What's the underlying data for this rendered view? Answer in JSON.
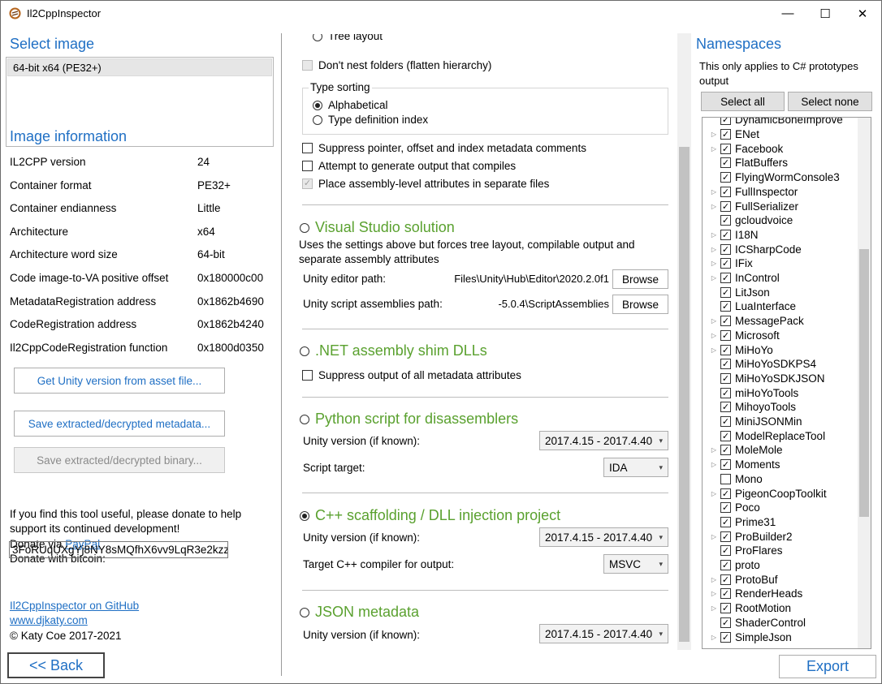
{
  "window": {
    "title": "Il2CppInspector",
    "min": "—",
    "max": "☐",
    "close": "✕"
  },
  "select_image": {
    "heading": "Select image",
    "items": [
      "64-bit x64 (PE32+)"
    ]
  },
  "image_info": {
    "heading": "Image information",
    "rows": [
      {
        "label": "IL2CPP version",
        "value": "24"
      },
      {
        "label": "Container format",
        "value": "PE32+"
      },
      {
        "label": "Container endianness",
        "value": "Little"
      },
      {
        "label": "Architecture",
        "value": "x64"
      },
      {
        "label": "Architecture word size",
        "value": "64-bit"
      },
      {
        "label": "Code image-to-VA positive offset",
        "value": "0x180000c00"
      },
      {
        "label": "MetadataRegistration address",
        "value": "0x1862b4690"
      },
      {
        "label": "CodeRegistration address",
        "value": "0x1862b4240"
      },
      {
        "label": "Il2CppCodeRegistration function",
        "value": "0x1800d0350"
      }
    ]
  },
  "buttons": {
    "get_unity": "Get Unity version from asset file...",
    "save_metadata": "Save extracted/decrypted metadata...",
    "save_binary": "Save extracted/decrypted binary...",
    "back": "<< Back",
    "export": "Export",
    "select_all": "Select all",
    "select_none": "Select none",
    "browse1": "Browse",
    "browse2": "Browse"
  },
  "donate": {
    "line1": "If you find this tool useful, please donate to help",
    "line2": "support its continued development!",
    "via": "Donate via ",
    "paypal": "PayPal",
    "bitcoin_label": "Donate with bitcoin:",
    "bitcoin_addr": "3FoRUqUXgYj8NY8sMQfhX6vv9LqR3e2kzz"
  },
  "links": {
    "github": "Il2CppInspector on GitHub",
    "site": "www.djkaty.com",
    "copyright": "© Katy Coe 2017-2021"
  },
  "options": {
    "tree_layout": "Tree layout",
    "dont_nest": "Don't nest folders (flatten hierarchy)",
    "type_sorting": "Type sorting",
    "alphabetical": "Alphabetical",
    "type_def_index": "Type definition index",
    "suppress_pointer": "Suppress pointer, offset and index metadata comments",
    "attempt_compile": "Attempt to generate output that compiles",
    "place_attrs": "Place assembly-level attributes in separate files"
  },
  "vs": {
    "heading": "Visual Studio solution",
    "desc1": "Uses the settings above but forces tree layout, compilable output and",
    "desc2": "separate assembly attributes",
    "editor_label": "Unity editor path:",
    "editor_path": "Files\\Unity\\Hub\\Editor\\2020.2.0f1",
    "script_label": "Unity script assemblies path:",
    "script_path": "-5.0.4\\ScriptAssemblies"
  },
  "shim": {
    "heading": ".NET assembly shim DLLs",
    "suppress": "Suppress output of all metadata attributes"
  },
  "python": {
    "heading": "Python script for disassemblers",
    "unity_label": "Unity version (if known):",
    "unity_value": "2017.4.15 - 2017.4.40",
    "target_label": "Script target:",
    "target_value": "IDA"
  },
  "cpp": {
    "heading": "C++ scaffolding / DLL injection project",
    "unity_label": "Unity version (if known):",
    "unity_value": "2017.4.15 - 2017.4.40",
    "compiler_label": "Target C++ compiler for output:",
    "compiler_value": "MSVC"
  },
  "json": {
    "heading": "JSON metadata",
    "unity_label": "Unity version (if known):",
    "unity_value": "2017.4.15 - 2017.4.40"
  },
  "namespaces": {
    "heading": "Namespaces",
    "note1": "This only applies to C# prototypes",
    "note2": "output",
    "items": [
      {
        "name": "DynamicBoneImprove",
        "exp": false,
        "chk": true
      },
      {
        "name": "ENet",
        "exp": true,
        "chk": true
      },
      {
        "name": "Facebook",
        "exp": true,
        "chk": true
      },
      {
        "name": "FlatBuffers",
        "exp": false,
        "chk": true
      },
      {
        "name": "FlyingWormConsole3",
        "exp": false,
        "chk": true
      },
      {
        "name": "FullInspector",
        "exp": true,
        "chk": true
      },
      {
        "name": "FullSerializer",
        "exp": true,
        "chk": true
      },
      {
        "name": "gcloudvoice",
        "exp": false,
        "chk": true
      },
      {
        "name": "I18N",
        "exp": true,
        "chk": true
      },
      {
        "name": "ICSharpCode",
        "exp": true,
        "chk": true
      },
      {
        "name": "IFix",
        "exp": true,
        "chk": true
      },
      {
        "name": "InControl",
        "exp": true,
        "chk": true
      },
      {
        "name": "LitJson",
        "exp": false,
        "chk": true
      },
      {
        "name": "LuaInterface",
        "exp": false,
        "chk": true
      },
      {
        "name": "MessagePack",
        "exp": true,
        "chk": true
      },
      {
        "name": "Microsoft",
        "exp": true,
        "chk": true
      },
      {
        "name": "MiHoYo",
        "exp": true,
        "chk": true
      },
      {
        "name": "MiHoYoSDKPS4",
        "exp": false,
        "chk": true
      },
      {
        "name": "MiHoYoSDKJSON",
        "exp": false,
        "chk": true
      },
      {
        "name": "miHoYoTools",
        "exp": false,
        "chk": true
      },
      {
        "name": "MihoyoTools",
        "exp": false,
        "chk": true
      },
      {
        "name": "MiniJSONMin",
        "exp": false,
        "chk": true
      },
      {
        "name": "ModelReplaceTool",
        "exp": false,
        "chk": true
      },
      {
        "name": "MoleMole",
        "exp": true,
        "chk": true
      },
      {
        "name": "Moments",
        "exp": true,
        "chk": true
      },
      {
        "name": "Mono",
        "exp": false,
        "chk": false
      },
      {
        "name": "PigeonCoopToolkit",
        "exp": true,
        "chk": true
      },
      {
        "name": "Poco",
        "exp": false,
        "chk": true
      },
      {
        "name": "Prime31",
        "exp": false,
        "chk": true
      },
      {
        "name": "ProBuilder2",
        "exp": true,
        "chk": true
      },
      {
        "name": "ProFlares",
        "exp": false,
        "chk": true
      },
      {
        "name": "proto",
        "exp": false,
        "chk": true
      },
      {
        "name": "ProtoBuf",
        "exp": true,
        "chk": true
      },
      {
        "name": "RenderHeads",
        "exp": true,
        "chk": true
      },
      {
        "name": "RootMotion",
        "exp": true,
        "chk": true
      },
      {
        "name": "ShaderControl",
        "exp": false,
        "chk": true
      },
      {
        "name": "SimpleJson",
        "exp": true,
        "chk": true
      }
    ]
  }
}
